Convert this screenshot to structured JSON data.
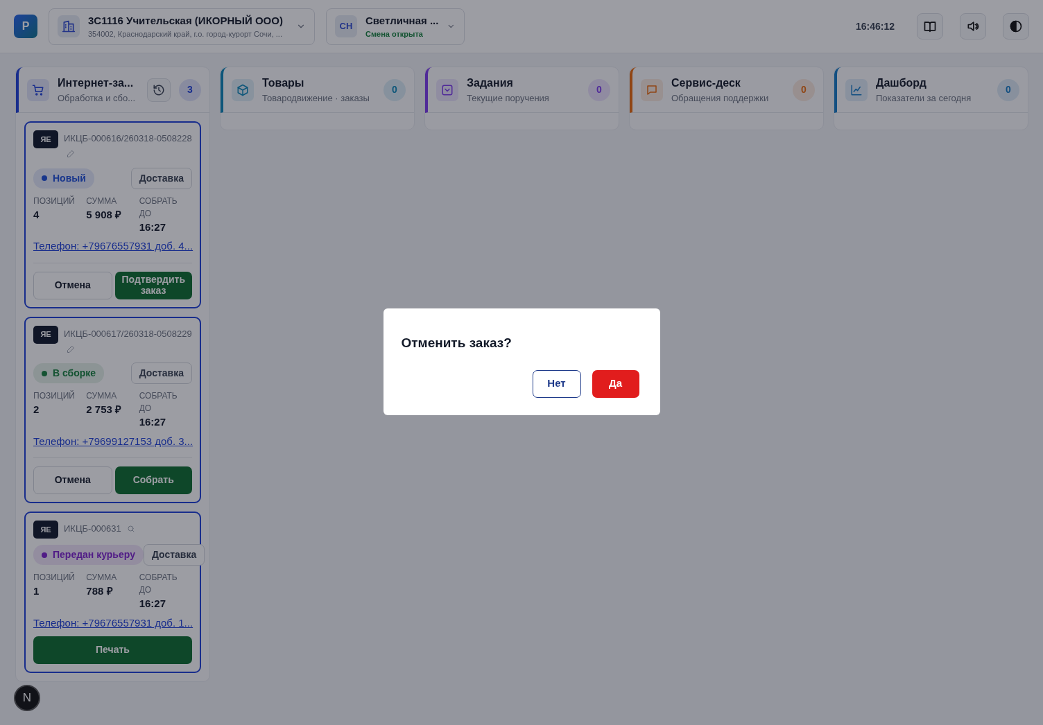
{
  "header": {
    "logo": "P",
    "store": {
      "title": "3С1116 Учительская (ИКОРНЫЙ ООО)",
      "address": "354002, Краснодарский край, г.о. город-курорт Сочи, ..."
    },
    "user": {
      "initials": "СН",
      "name": "Светличная ...",
      "status": "Смена открыта"
    },
    "clock": "16:46:12"
  },
  "columns": [
    {
      "kind": "cart",
      "title": "Интернет-за...",
      "subtitle": "Обработка и сбо...",
      "count": "3",
      "history": true
    },
    {
      "kind": "box",
      "title": "Товары",
      "subtitle": "Товародвижение · заказы",
      "count": "0",
      "history": false
    },
    {
      "kind": "inbox",
      "title": "Задания",
      "subtitle": "Текущие поручения",
      "count": "0",
      "history": false
    },
    {
      "kind": "chat",
      "title": "Сервис-деск",
      "subtitle": "Обращения поддержки",
      "count": "0",
      "history": false
    },
    {
      "kind": "chart",
      "title": "Дашборд",
      "subtitle": "Показатели за сегодня",
      "count": "0",
      "history": false
    }
  ],
  "orders": [
    {
      "badge": "ЯЕ",
      "number": "ИКЦБ-000616/260318-0508228",
      "editable": true,
      "status": {
        "label": "Новый",
        "kind": "new"
      },
      "delivery": "Доставка",
      "stats": [
        {
          "label": "ПОЗИЦИЙ",
          "value": "4"
        },
        {
          "label": "СУММА",
          "value": "5 908 ₽"
        },
        {
          "label": "СОБРАТЬ ДО",
          "value": "16:27"
        }
      ],
      "phone": "Телефон: +79676557931 доб. 4...",
      "divider": true,
      "buttons": [
        {
          "label": "Отмена",
          "kind": "outline"
        },
        {
          "label": "Подтвердить заказ",
          "kind": "primary"
        }
      ]
    },
    {
      "badge": "ЯЕ",
      "number": "ИКЦБ-000617/260318-0508229",
      "editable": true,
      "status": {
        "label": "В сборке",
        "kind": "assembling"
      },
      "delivery": "Доставка",
      "stats": [
        {
          "label": "ПОЗИЦИЙ",
          "value": "2"
        },
        {
          "label": "СУММА",
          "value": "2 753 ₽"
        },
        {
          "label": "СОБРАТЬ ДО",
          "value": "16:27"
        }
      ],
      "phone": "Телефон: +79699127153 доб. 3...",
      "divider": true,
      "buttons": [
        {
          "label": "Отмена",
          "kind": "outline"
        },
        {
          "label": "Собрать",
          "kind": "primary"
        }
      ]
    },
    {
      "badge": "ЯЕ",
      "number": "ИКЦБ-000631",
      "editable": false,
      "status": {
        "label": "Передан курьеру",
        "kind": "courier"
      },
      "delivery": "Доставка",
      "stats": [
        {
          "label": "ПОЗИЦИЙ",
          "value": "1"
        },
        {
          "label": "СУММА",
          "value": "788 ₽"
        },
        {
          "label": "СОБРАТЬ ДО",
          "value": "16:27"
        }
      ],
      "phone": "Телефон: +79676557931 доб. 1...",
      "divider": false,
      "buttons": [
        {
          "label": "Печать",
          "kind": "primary"
        }
      ]
    }
  ],
  "dialog": {
    "title": "Отменить заказ?",
    "buttons": [
      {
        "label": "Нет",
        "kind": "outline"
      },
      {
        "label": "Да",
        "kind": "danger"
      }
    ]
  },
  "fab": "N"
}
